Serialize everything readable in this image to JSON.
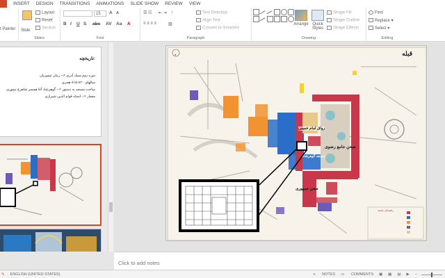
{
  "menu": {
    "tabs": [
      "INSERT",
      "DESIGN",
      "TRANSITIONS",
      "ANIMATIONS",
      "SLIDE SHOW",
      "REVIEW",
      "VIEW"
    ]
  },
  "ribbon": {
    "clipboard": {
      "format_painter": "t Painter"
    },
    "slides": {
      "new_slide": "New",
      "new_slide2": "Slide",
      "layout": "Layout",
      "reset": "Reset",
      "section": "Section",
      "label": "Slides"
    },
    "font": {
      "size": "15",
      "label": "Font"
    },
    "paragraph": {
      "text_direction": "Text Direction",
      "align_text": "Align Text",
      "convert_smartart": "Convert to SmartArt",
      "label": "Paragraph"
    },
    "drawing": {
      "arrange": "Arrange",
      "quick_styles": "Quick",
      "quick_styles2": "Styles",
      "shape_fill": "Shape Fill",
      "shape_outline": "Shape Outline",
      "shape_effects": "Shape Effects",
      "label": "Drawing"
    },
    "editing": {
      "find": "Find",
      "replace": "Replace",
      "select": "Select",
      "label": "Editing"
    }
  },
  "thumbnails": {
    "slide1": {
      "title": ":تاریخچه",
      "lines": [
        "دوره دوم سبک آذری <-- زمان تیموریان",
        "سالهای ۸۲۰-۸۱۵ هجری",
        "ساخت مسجد به دستور <-- گوهرشاد آغا همسر شاهرخ تیموری",
        "معمار <-- استاد قوام الدین شیرازی"
      ]
    }
  },
  "slide": {
    "labels": {
      "qibla": "قبله",
      "riwaq": "رواق امام خمینی",
      "sahn_jame": "صحن جامع رضوی",
      "masjid": "مسجد گوهرشاد",
      "sahn_jomhuri": "صحن جمهوری",
      "legend_title": "راهنمای نقشه"
    }
  },
  "notes": {
    "placeholder": "Click to add notes"
  },
  "status": {
    "language": "ENGLISH (UNITED STATES)",
    "notes": "NOTES",
    "comments": "COMMENTS"
  },
  "colors": {
    "accent": "#d24726",
    "map_red": "#c8384a",
    "map_blue": "#2a6ec9",
    "map_orange": "#f19332",
    "map_purple": "#6c5bb8"
  }
}
